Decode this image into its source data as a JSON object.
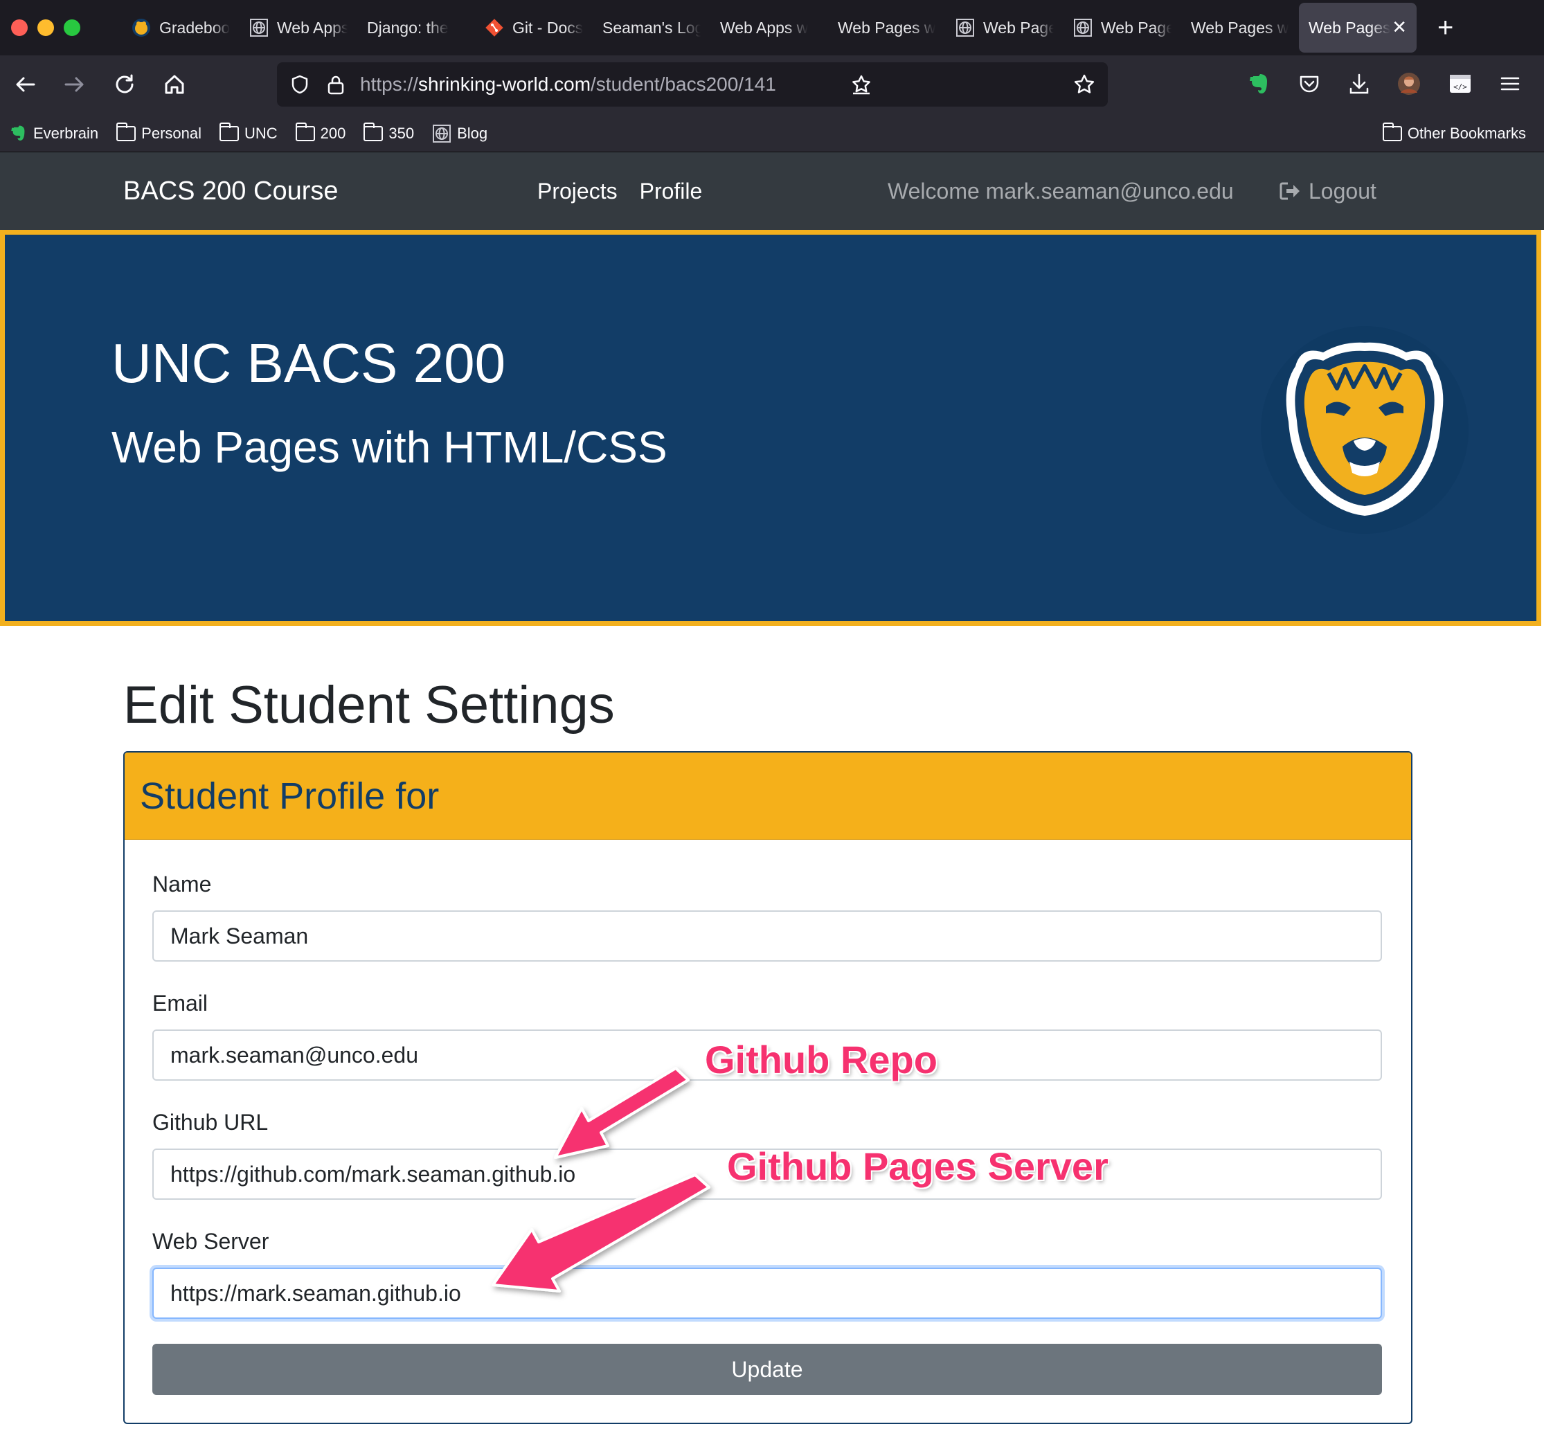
{
  "browser": {
    "tabs": [
      {
        "title": "Gradebook",
        "icon": "unc-bear-icon"
      },
      {
        "title": "Web Apps",
        "icon": "globe-icon"
      },
      {
        "title": "Django: the",
        "icon": "none"
      },
      {
        "title": "Git - Docs",
        "icon": "git-icon"
      },
      {
        "title": "Seaman's Log",
        "icon": "none"
      },
      {
        "title": "Web Apps w",
        "icon": "none"
      },
      {
        "title": "Web Pages w",
        "icon": "none"
      },
      {
        "title": "Web Pages",
        "icon": "globe-icon"
      },
      {
        "title": "Web Pages",
        "icon": "globe-icon"
      },
      {
        "title": "Web Pages w",
        "icon": "none"
      },
      {
        "title": "Web Pages",
        "icon": "none",
        "active": true
      }
    ],
    "url": {
      "scheme": "https://",
      "host": "shrinking-world.com",
      "path": "/student/bacs200/141"
    },
    "bookmarks": [
      {
        "label": "Everbrain",
        "icon": "evernote-icon"
      },
      {
        "label": "Personal",
        "icon": "folder-icon"
      },
      {
        "label": "UNC",
        "icon": "folder-icon"
      },
      {
        "label": "200",
        "icon": "folder-icon"
      },
      {
        "label": "350",
        "icon": "folder-icon"
      },
      {
        "label": "Blog",
        "icon": "globe-icon"
      }
    ],
    "other_bookmarks": "Other Bookmarks"
  },
  "site_nav": {
    "brand": "BACS 200 Course",
    "links": [
      "Projects",
      "Profile"
    ],
    "welcome": "Welcome mark.seaman@unco.edu",
    "logout": "Logout"
  },
  "hero": {
    "title": "UNC BACS 200",
    "subtitle": "Web Pages with HTML/CSS",
    "logo_icon": "unc-bear-logo"
  },
  "page": {
    "title": "Edit Student Settings"
  },
  "form": {
    "card_title": "Student Profile for",
    "fields": [
      {
        "label": "Name",
        "value": "Mark Seaman"
      },
      {
        "label": "Email",
        "value": "mark.seaman@unco.edu"
      },
      {
        "label": "Github URL",
        "value": "https://github.com/mark.seaman.github.io"
      },
      {
        "label": "Web Server",
        "value": "https://mark.seaman.github.io"
      }
    ],
    "submit_label": "Update"
  },
  "annotations": {
    "repo": "Github Repo",
    "pages": "Github Pages Server"
  },
  "colors": {
    "unc_navy": "#123d67",
    "unc_gold": "#f5b01a",
    "annotation_pink": "#f6316f",
    "nav_dark": "#343a40",
    "button_gray": "#6c757d"
  }
}
